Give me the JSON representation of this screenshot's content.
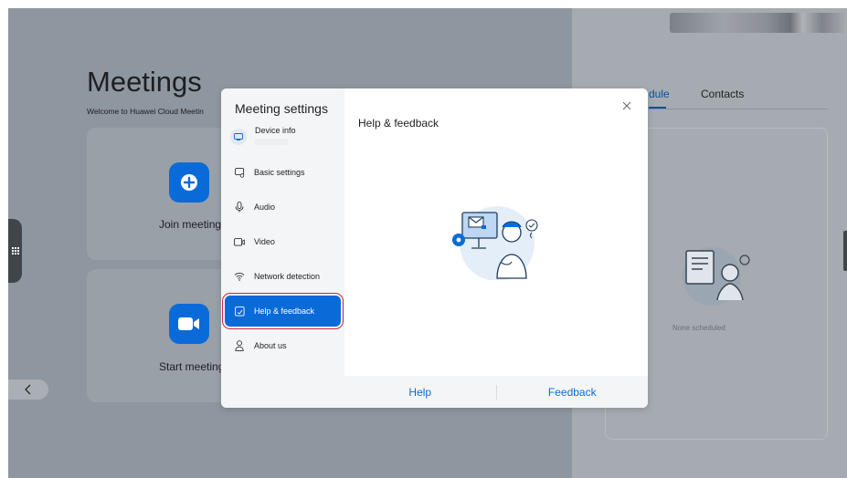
{
  "background": {
    "title": "Meetings",
    "subtitle": "Welcome to Huawei Cloud Meetin",
    "join_label": "Join meeting",
    "start_label": "Start meeting",
    "tabs": [
      {
        "label": "dule",
        "active": true
      },
      {
        "label": "Contacts",
        "active": false
      }
    ],
    "empty_text": "None scheduled"
  },
  "dialog": {
    "title": "Meeting settings",
    "device_info_label": "Device info",
    "nav": [
      {
        "label": "Basic settings",
        "icon": "basic-settings-icon"
      },
      {
        "label": "Audio",
        "icon": "microphone-icon"
      },
      {
        "label": "Video",
        "icon": "camera-icon"
      },
      {
        "label": "Network detection",
        "icon": "wifi-icon"
      },
      {
        "label": "Help & feedback",
        "icon": "help-feedback-icon",
        "active": true
      },
      {
        "label": "About us",
        "icon": "person-icon"
      }
    ],
    "content_title": "Help & feedback",
    "footer": {
      "help": "Help",
      "feedback": "Feedback"
    }
  },
  "colors": {
    "accent": "#0a6bd8",
    "highlight_outline": "#c7283a"
  }
}
